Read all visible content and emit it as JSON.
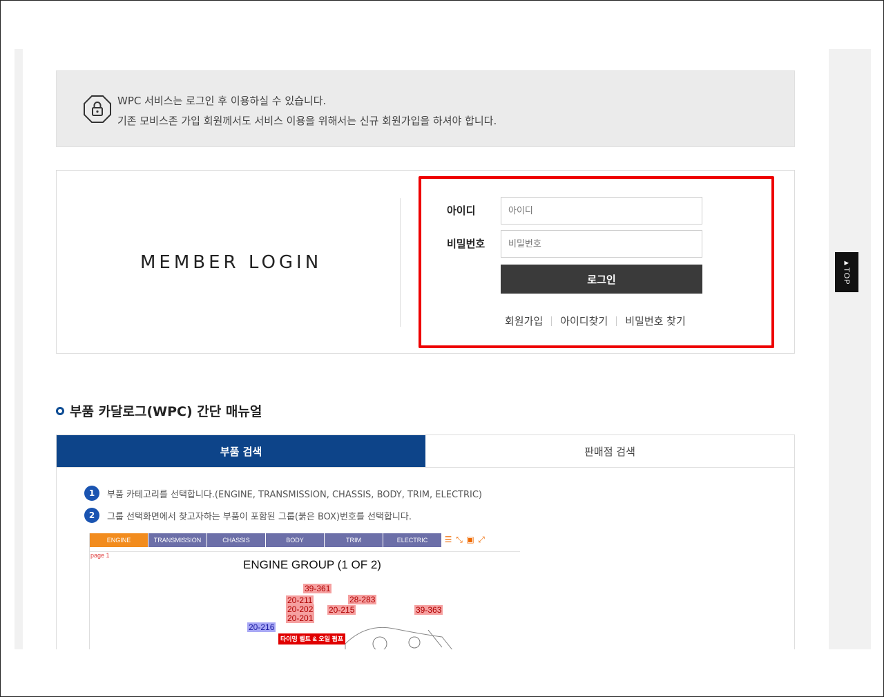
{
  "notice": {
    "line1": "WPC 서비스는 로그인 후 이용하실 수 있습니다.",
    "line2": "기존 모비스존 가입 회원께서도 서비스 이용을 위해서는 신규 회원가입을 하셔야 합니다."
  },
  "login": {
    "title": "MEMBER LOGIN",
    "id_label": "아이디",
    "id_placeholder": "아이디",
    "id_value": "",
    "pw_label": "비밀번호",
    "pw_placeholder": "비밀번호",
    "pw_value": "",
    "submit_label": "로그인",
    "links": [
      "회원가입",
      "아이디찾기",
      "비밀번호 찾기"
    ]
  },
  "top_button": {
    "label": "▲TOP"
  },
  "manual": {
    "title": "부품 카달로그(WPC) 간단 매뉴얼",
    "tabs": [
      "부품 검색",
      "판매점 검색"
    ],
    "active_tab": "부품 검색",
    "steps": [
      {
        "num": "1",
        "text": "부품 카테고리를 선택합니다.(ENGINE, TRANSMISSION, CHASSIS, BODY, TRIM, ELECTRIC)"
      },
      {
        "num": "2",
        "text": "그룹 선택화면에서 찾고자하는 부품이 포함된 그룹(붉은 BOX)번호를 선택합니다."
      }
    ],
    "screenshot": {
      "categories": [
        "ENGINE",
        "TRANSMISSION",
        "CHASSIS",
        "BODY",
        "TRIM",
        "ELECTRIC"
      ],
      "active_category": "ENGINE",
      "page_label": "page 1",
      "group_title": "ENGINE GROUP (1 OF 2)",
      "tags": [
        "39-361",
        "20-211",
        "20-202",
        "20-201",
        "28-283",
        "20-215",
        "39-363",
        "20-216"
      ],
      "highlight_label": "타이밍 벨트 & 오일 펌프"
    }
  },
  "colors": {
    "accent_blue": "#0d4489",
    "highlight_red": "#ee0000",
    "login_button": "#3a3a3a",
    "step_badge": "#1a54b1",
    "category_active": "#f28c1e",
    "category_inactive": "#6c6fa8"
  },
  "icons": {
    "notice": "lock-icon",
    "title_bullet": "circle-bullet-icon",
    "toolbar": [
      "list-icon",
      "collapse-icon",
      "fit-icon",
      "expand-icon"
    ]
  }
}
